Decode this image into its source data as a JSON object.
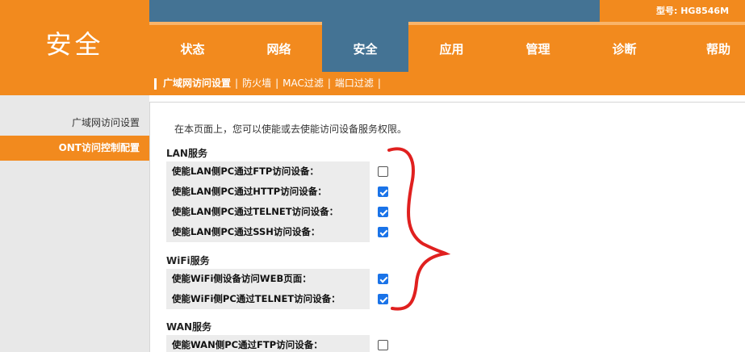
{
  "brand": "安全",
  "model_label": "型号: HG8546M",
  "nav": [
    {
      "label": "状态",
      "active": false
    },
    {
      "label": "网络",
      "active": false
    },
    {
      "label": "安全",
      "active": true
    },
    {
      "label": "应用",
      "active": false
    },
    {
      "label": "管理",
      "active": false
    },
    {
      "label": "诊断",
      "active": false
    },
    {
      "label": "帮助",
      "active": false
    }
  ],
  "subnav": {
    "current": "广域网访问设置",
    "items": [
      "防火墙",
      "MAC过滤",
      "端口过滤"
    ],
    "separator": "|"
  },
  "sidebar": [
    {
      "label": "广域网访问设置",
      "active": false
    },
    {
      "label": "ONT访问控制配置",
      "active": true
    }
  ],
  "content": {
    "intro": "在本页面上，您可以使能或去使能访问设备服务权限。",
    "sections": [
      {
        "title": "LAN服务",
        "rows": [
          {
            "label": "使能LAN侧PC通过FTP访问设备：",
            "checked": false
          },
          {
            "label": "使能LAN侧PC通过HTTP访问设备：",
            "checked": true
          },
          {
            "label": "使能LAN侧PC通过TELNET访问设备：",
            "checked": true
          },
          {
            "label": "使能LAN侧PC通过SSH访问设备：",
            "checked": true
          }
        ]
      },
      {
        "title": "WiFi服务",
        "rows": [
          {
            "label": "使能WiFi侧设备访问WEB页面：",
            "checked": true
          },
          {
            "label": "使能WiFi侧PC通过TELNET访问设备：",
            "checked": true
          }
        ]
      },
      {
        "title": "WAN服务",
        "rows": [
          {
            "label": "使能WAN侧PC通过FTP访问设备：",
            "checked": false
          }
        ]
      }
    ]
  },
  "colors": {
    "orange": "#f28a1e",
    "blue": "#447394",
    "checkbox_blue": "#1a73e8",
    "annotation_red": "#e0201f"
  }
}
